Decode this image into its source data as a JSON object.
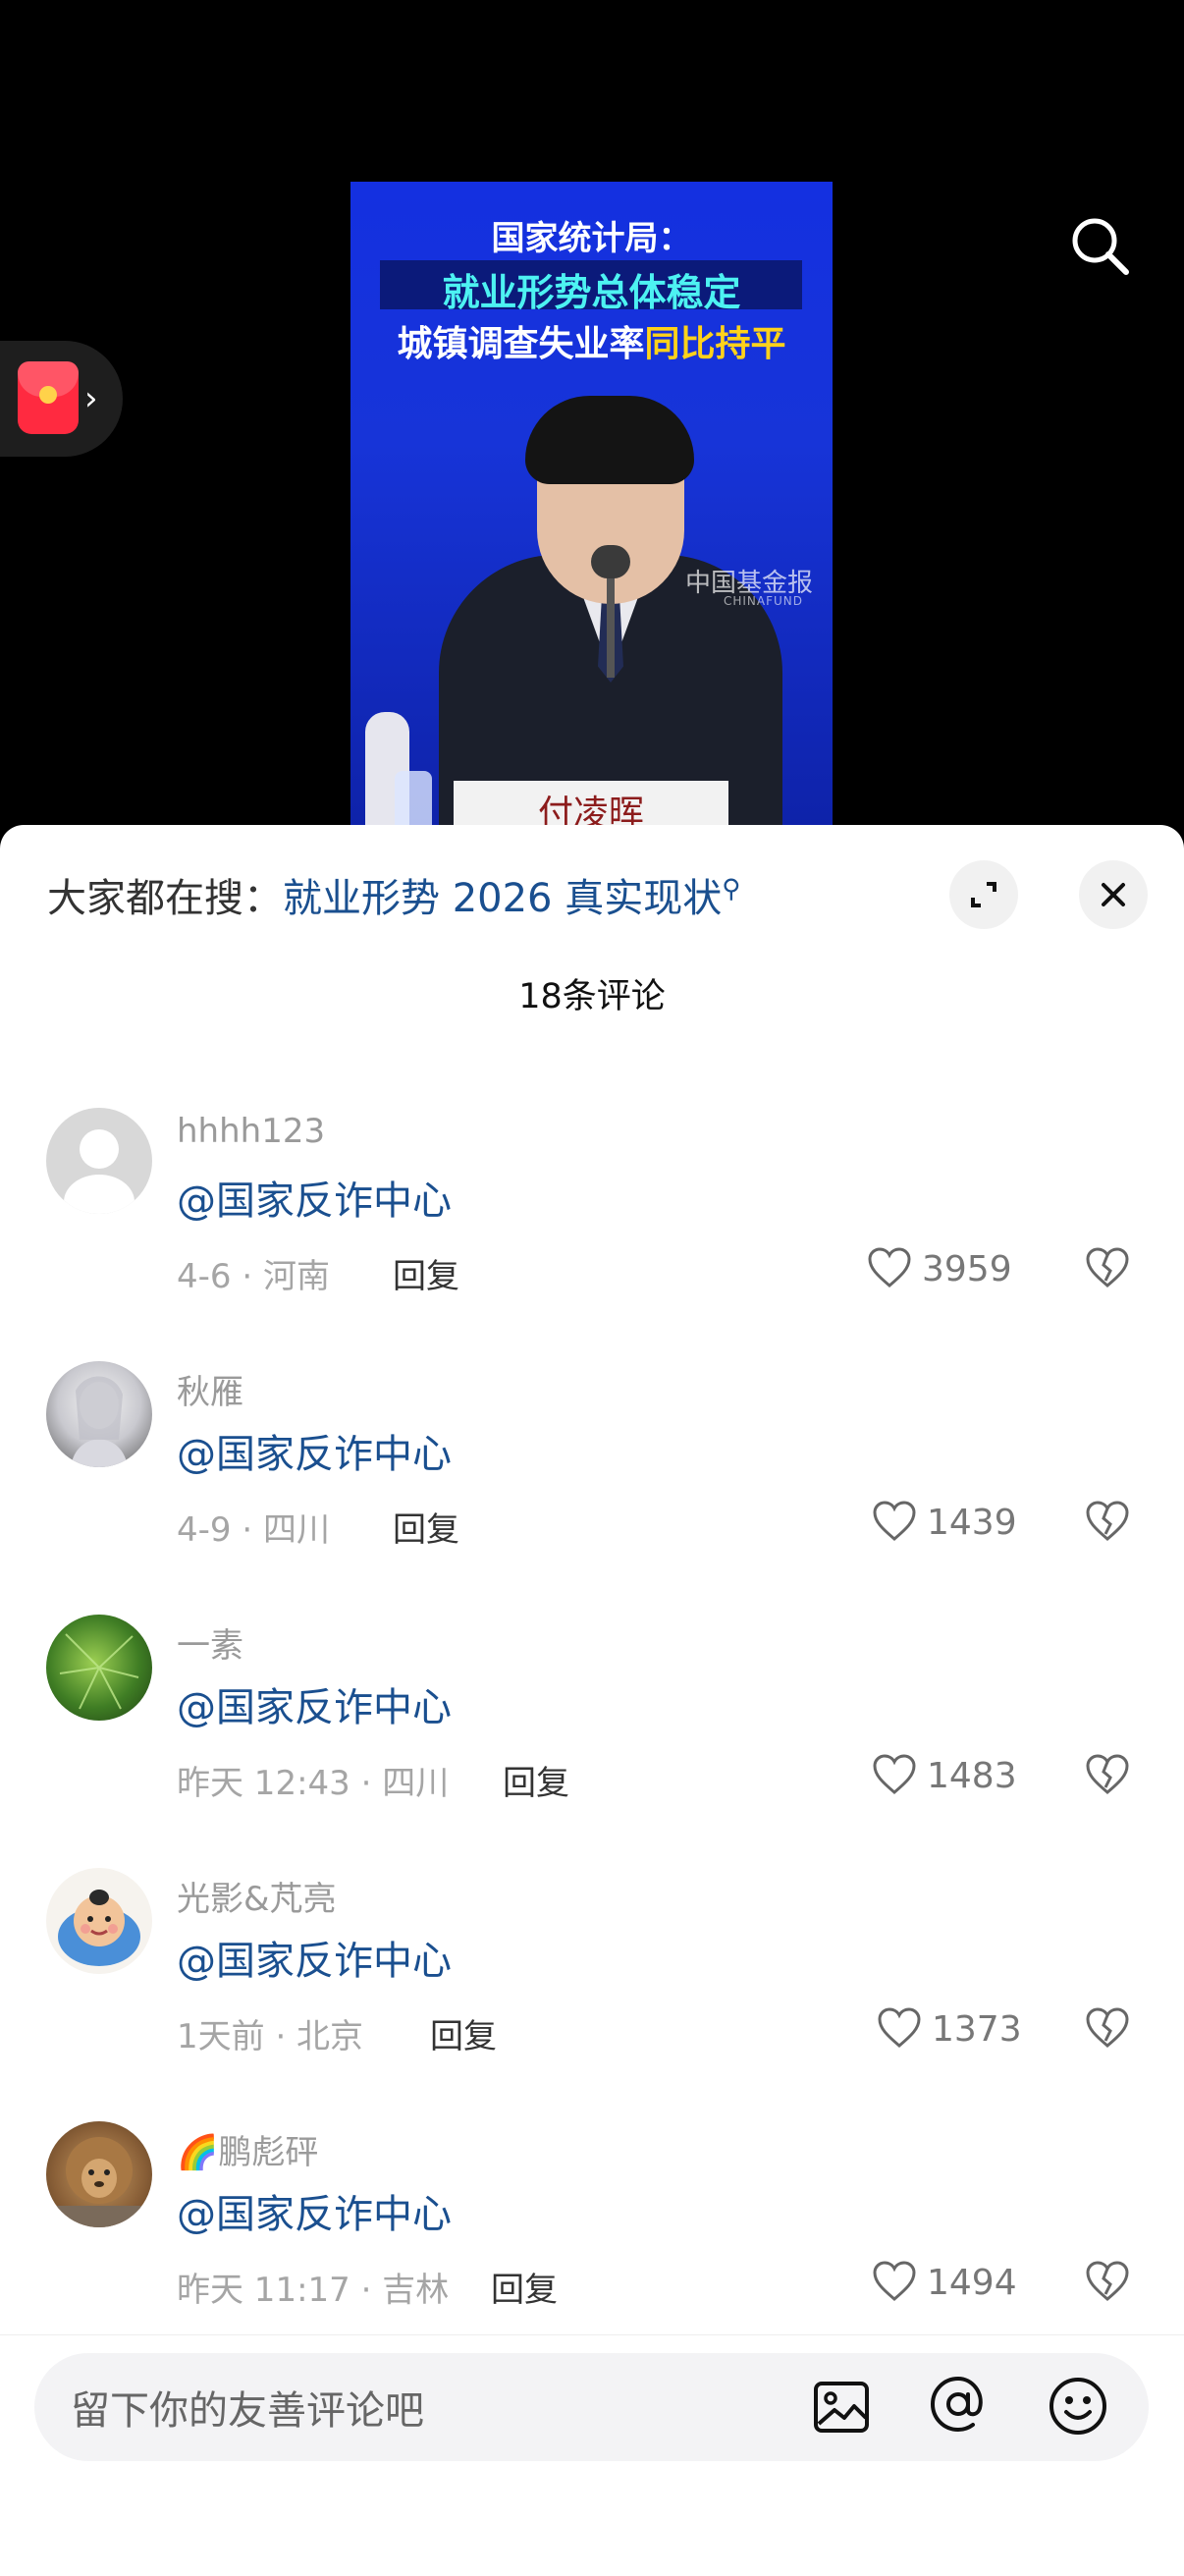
{
  "video": {
    "headline_line1": "国家统计局：",
    "headline_line2": "就业形势总体稳定",
    "headline_line3_prefix": "城镇调查失业率",
    "headline_line3_highlight": "同比持平",
    "watermark": "中国基金报",
    "watermark_sub": "CHINAFUND",
    "nameplate": "付凌晖"
  },
  "top_controls": {
    "search_icon": "search-icon",
    "red_packet_icon": "red-packet-icon"
  },
  "sheet": {
    "hot_search_prefix": "大家都在搜：",
    "hot_search_keyword": "就业形势 2026 真实现状",
    "comment_count": "18条评论"
  },
  "comments": [
    {
      "user": "hhhh123",
      "text": "@国家反诈中心",
      "meta": "4-6 · 河南",
      "reply": "回复",
      "likes": "3959"
    },
    {
      "user": "秋雁",
      "text": "@国家反诈中心",
      "meta": "4-9 · 四川",
      "reply": "回复",
      "likes": "1439"
    },
    {
      "user": "一素",
      "text": "@国家反诈中心",
      "meta": "昨天 12:43 · 四川",
      "reply": "回复",
      "likes": "1483"
    },
    {
      "user": "光影&芃亮",
      "text": "@国家反诈中心",
      "meta": "1天前 · 北京",
      "reply": "回复",
      "likes": "1373"
    },
    {
      "user": "🌈鹏彪砰",
      "text": "@国家反诈中心",
      "meta": "昨天 11:17 · 吉林",
      "reply": "回复",
      "likes": "1494"
    }
  ],
  "input": {
    "placeholder": "留下你的友善评论吧"
  },
  "colors": {
    "link": "#1a4f8f",
    "sheet_bg": "#ffffff",
    "video_blue": "#1430e0",
    "red_packet": "#ff2a40"
  }
}
